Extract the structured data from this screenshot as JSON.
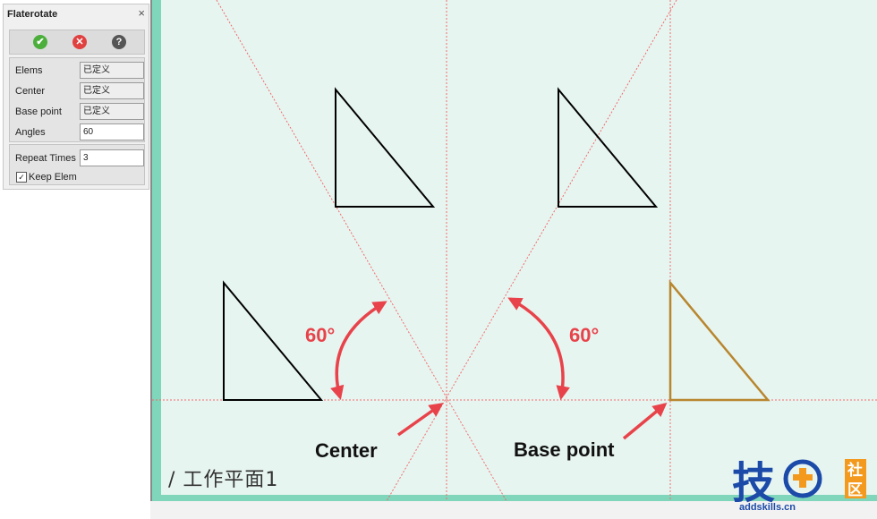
{
  "dialog": {
    "title": "Flaterotate",
    "close_glyph": "×",
    "buttons": {
      "ok_icon": "✔",
      "cancel_icon": "✕",
      "help_icon": "?"
    },
    "fields": [
      {
        "label": "Elems",
        "value": "已定义"
      },
      {
        "label": "Center",
        "value": "已定义"
      },
      {
        "label": "Base point",
        "value": "已定义"
      },
      {
        "label": "Angles",
        "value": "60"
      }
    ],
    "repeat": {
      "label": "Repeat Times",
      "value": "3"
    },
    "keep": {
      "label": "Keep Elem",
      "checked": true,
      "mark": "✓"
    }
  },
  "canvas": {
    "watermark": "/ 工作平面1"
  },
  "annotations": {
    "angle_left": "60°",
    "angle_right": "60°",
    "center_label": "Center",
    "base_label": "Base point"
  },
  "logo": {
    "main": "技",
    "side_top": "社",
    "side_bottom": "区",
    "url": "addskills.cn"
  },
  "colors": {
    "accent_arrow": "#e8434a",
    "guide_line": "#f06a6a",
    "result_triangle": "#b8862e",
    "logo_blue": "#1b4aa8",
    "logo_orange": "#f39a1e"
  }
}
